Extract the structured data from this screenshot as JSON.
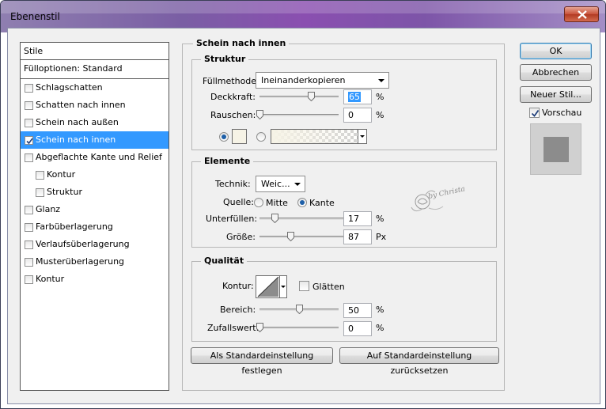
{
  "window": {
    "title": "Ebenenstil"
  },
  "styles_panel": {
    "header": "Stile",
    "blending": "Fülloptionen: Standard",
    "items": [
      {
        "label": "Schlagschatten",
        "checked": false,
        "sub": false,
        "selected": false
      },
      {
        "label": "Schatten nach innen",
        "checked": false,
        "sub": false,
        "selected": false
      },
      {
        "label": "Schein nach außen",
        "checked": false,
        "sub": false,
        "selected": false
      },
      {
        "label": "Schein nach innen",
        "checked": true,
        "sub": false,
        "selected": true
      },
      {
        "label": "Abgeflachte Kante und Relief",
        "checked": false,
        "sub": false,
        "selected": false
      },
      {
        "label": "Kontur",
        "checked": false,
        "sub": true,
        "selected": false
      },
      {
        "label": "Struktur",
        "checked": false,
        "sub": true,
        "selected": false
      },
      {
        "label": "Glanz",
        "checked": false,
        "sub": false,
        "selected": false
      },
      {
        "label": "Farbüberlagerung",
        "checked": false,
        "sub": false,
        "selected": false
      },
      {
        "label": "Verlaufsüberlagerung",
        "checked": false,
        "sub": false,
        "selected": false
      },
      {
        "label": "Musterüberlagerung",
        "checked": false,
        "sub": false,
        "selected": false
      },
      {
        "label": "Kontur",
        "checked": false,
        "sub": false,
        "selected": false
      }
    ]
  },
  "main": {
    "title": "Schein nach innen",
    "struktur": {
      "title": "Struktur",
      "fuellmethode_label": "Füllmethode:",
      "fuellmethode_value": "Ineinanderkopieren",
      "deckkraft_label": "Deckkraft:",
      "deckkraft_value": "65",
      "deckkraft_unit": "%",
      "deckkraft_level": 0.65,
      "rauschen_label": "Rauschen:",
      "rauschen_value": "0",
      "rauschen_unit": "%",
      "rauschen_level": 0.0
    },
    "elemente": {
      "title": "Elemente",
      "technik_label": "Technik:",
      "technik_value": "Weic...",
      "quelle_label": "Quelle:",
      "quelle_mitte": "Mitte",
      "quelle_kante": "Kante",
      "unterfuellen_label": "Unterfüllen:",
      "unterfuellen_value": "17",
      "unterfuellen_unit": "%",
      "unterfuellen_level": 0.17,
      "groesse_label": "Größe:",
      "groesse_value": "87",
      "groesse_unit": "Px",
      "groesse_level": 0.35,
      "watermark": "by Christa"
    },
    "qualitaet": {
      "title": "Qualität",
      "kontur_label": "Kontur:",
      "glaetten_label": "Glätten",
      "bereich_label": "Bereich:",
      "bereich_value": "50",
      "bereich_unit": "%",
      "bereich_level": 0.5,
      "zufallswert_label": "Zufallswert:",
      "zufallswert_value": "0",
      "zufallswert_unit": "%",
      "zufallswert_level": 0.0
    },
    "btn_set_default": "Als Standardeinstellung festlegen",
    "btn_reset_default": "Auf Standardeinstellung zurücksetzen"
  },
  "right": {
    "ok": "OK",
    "abbrechen": "Abbrechen",
    "neuer_stil": "Neuer Stil...",
    "vorschau": "Vorschau",
    "vorschau_checked": true
  },
  "colors": {
    "selection": "#3399ff",
    "preview_square": "#8c8c8c"
  }
}
